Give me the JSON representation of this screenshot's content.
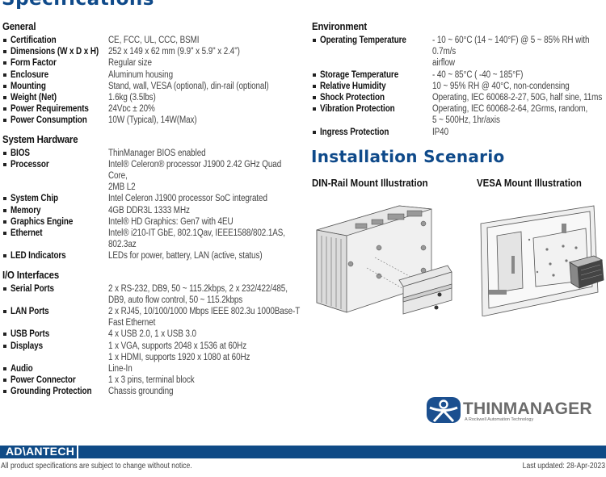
{
  "page": {
    "title": "Specifications",
    "install_title": "Installation Scenario"
  },
  "sections": {
    "general": {
      "title": "General",
      "rows": [
        {
          "label": "Certification",
          "value": "CE, FCC, UL, CCC, BSMI"
        },
        {
          "label": "Dimensions (W x D x H)",
          "value": "252 x 149 x 62 mm (9.9\" x 5.9\" x 2.4\")"
        },
        {
          "label": "Form Factor",
          "value": "Regular size"
        },
        {
          "label": "Enclosure",
          "value": "Aluminum housing"
        },
        {
          "label": "Mounting",
          "value": "Stand, wall, VESA (optional), din-rail (optional)"
        },
        {
          "label": "Weight (Net)",
          "value": "1.6kg (3.5lbs)"
        },
        {
          "label": "Power Requirements",
          "value": "24Vᴅᴄ ± 20%"
        },
        {
          "label": "Power Consumption",
          "value": "10W (Typical), 14W(Max)"
        }
      ]
    },
    "system_hardware": {
      "title": "System Hardware",
      "rows": [
        {
          "label": "BIOS",
          "value": "ThinManager BIOS enabled"
        },
        {
          "label": "Processor",
          "value": "Intel® Celeron® processor J1900 2.42 GHz Quad Core,\n2MB L2"
        },
        {
          "label": "System Chip",
          "value": "Intel Celeron J1900 processor SoC integrated"
        },
        {
          "label": "Memory",
          "value": "4GB DDR3L 1333 MHz"
        },
        {
          "label": "Graphics Engine",
          "value": "Intel® HD Graphics: Gen7 with 4EU"
        },
        {
          "label": "Ethernet",
          "value": "Intel® i210-IT GbE, 802.1Qav, IEEE1588/802.1AS,\n802.3az"
        },
        {
          "label": "LED Indicators",
          "value": "LEDs for power, battery, LAN (active, status)"
        }
      ]
    },
    "io_interfaces": {
      "title": "I/O Interfaces",
      "rows": [
        {
          "label": "Serial Ports",
          "value": "2 x RS-232, DB9, 50 ~ 115.2kbps, 2 x 232/422/485,\nDB9, auto flow control, 50 ~ 115.2kbps"
        },
        {
          "label": "LAN Ports",
          "value": "2 x RJ45, 10/100/1000 Mbps IEEE 802.3u 1000Base-T\nFast Ethernet"
        },
        {
          "label": "USB Ports",
          "value": "4 x USB 2.0, 1 x USB 3.0"
        },
        {
          "label": "Displays",
          "value": "1 x VGA, supports 2048 x 1536 at 60Hz\n1 x HDMI, supports 1920 x 1080 at 60Hz"
        },
        {
          "label": "Audio",
          "value": "Line-In"
        },
        {
          "label": "Power Connector",
          "value": "1 x 3 pins, terminal block"
        },
        {
          "label": "Grounding Protection",
          "value": "Chassis grounding"
        }
      ]
    },
    "environment": {
      "title": "Environment",
      "rows": [
        {
          "label": "Operating Temperature",
          "value": "- 10 ~ 60°C (14 ~ 140°F) @ 5 ~ 85% RH with 0.7m/s\nairflow"
        },
        {
          "label": "Storage Temperature",
          "value": "- 40 ~ 85°C ( -40 ~ 185°F)"
        },
        {
          "label": "Relative Humidity",
          "value": "10 ~ 95% RH @ 40°C, non-condensing"
        },
        {
          "label": "Shock Protection",
          "value": "Operating, IEC 60068-2-27, 50G, half sine, 11ms"
        },
        {
          "label": "Vibration Protection",
          "value": "Operating, IEC 60068-2-64, 2Grms, random,\n5 ~ 500Hz, 1hr/axis"
        },
        {
          "label": "Ingress Protection",
          "value": "IP40"
        }
      ]
    }
  },
  "illustrations": {
    "din_rail_title": "DIN-Rail Mount Illustration",
    "vesa_title": "VESA Mount Illustration"
  },
  "logo": {
    "name": "THINMANAGER",
    "tagline": "A Rockwell Automation Technology",
    "icon": "thinmanager-person-icon"
  },
  "footer": {
    "brand": "AD\\ANTECH",
    "note": "All product specifications are subject to change without notice.",
    "last_updated": "Last updated: 28-Apr-2023"
  },
  "colors": {
    "brand_blue": "#0f4a8a",
    "text": "#333333"
  }
}
